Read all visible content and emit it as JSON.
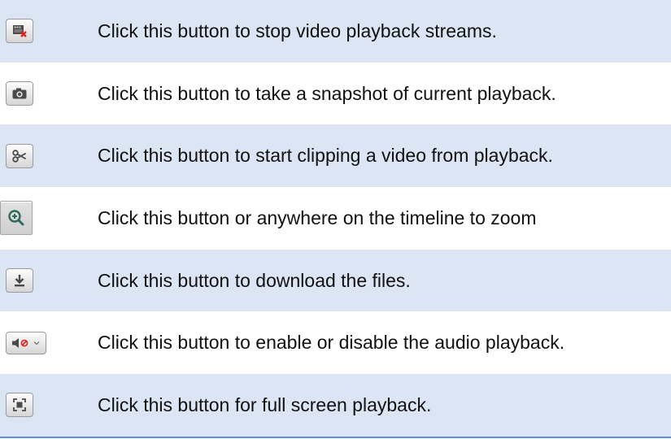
{
  "rows": [
    {
      "icon": "stop-playback-icon",
      "text": "Click this button to stop video playback streams."
    },
    {
      "icon": "camera-snapshot-icon",
      "text": "Click this button to take a snapshot of current playback."
    },
    {
      "icon": "scissors-clip-icon",
      "text": "Click this button to start clipping a video from playback."
    },
    {
      "icon": "zoom-in-icon",
      "text": "Click this button or anywhere on the timeline to zoom"
    },
    {
      "icon": "download-icon",
      "text": "Click this button to download the files."
    },
    {
      "icon": "audio-mute-icon",
      "text": "Click this button to enable or disable the audio playback."
    },
    {
      "icon": "full-screen-icon",
      "text": "Click this button for full screen playback."
    }
  ],
  "colors": {
    "row_shade": "#dbe5f3",
    "bottom_rule": "#5b8fd6",
    "stop_x": "#e0231b",
    "mute_slash": "#e0231b"
  }
}
